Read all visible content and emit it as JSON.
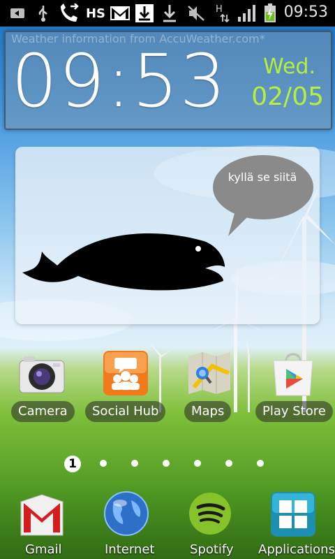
{
  "status_bar": {
    "time": "09:53",
    "icons": [
      "back-icon",
      "usb-icon",
      "call-forward-icon",
      "hs-icon",
      "gmail-icon",
      "download-icon",
      "download-complete-icon",
      "mute-icon",
      "data-arrows-icon",
      "signal-icon",
      "battery-charging-icon"
    ],
    "hs_label": "HS",
    "data_label": "H"
  },
  "clock_widget": {
    "weather_note": "Weather information from AccuWeather.com*",
    "time": "09:53",
    "day": "Wed.",
    "date": "02/05",
    "accent_color": "#b7f03a"
  },
  "fish_widget": {
    "speech": "kyllä se siitä"
  },
  "apps": [
    {
      "label": "Camera"
    },
    {
      "label": "Social Hub"
    },
    {
      "label": "Maps"
    },
    {
      "label": "Play Store"
    }
  ],
  "page_indicator": {
    "current": "1",
    "total_pages": 7
  },
  "dock": [
    {
      "label": "Gmail"
    },
    {
      "label": "Internet"
    },
    {
      "label": "Spotify"
    },
    {
      "label": "Applications"
    }
  ]
}
